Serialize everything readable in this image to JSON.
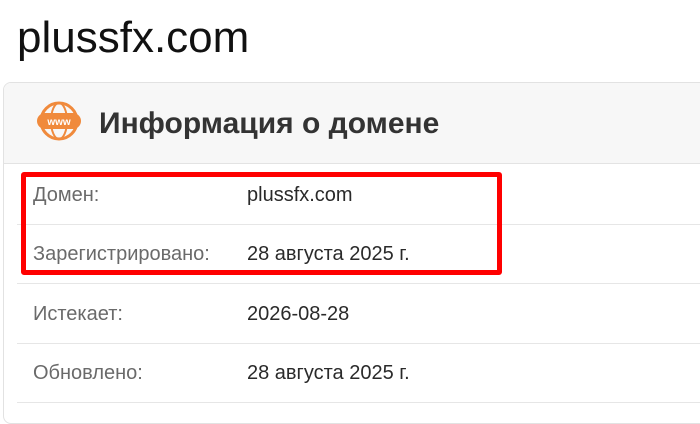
{
  "page": {
    "title": "plussfx.com"
  },
  "card": {
    "title": "Информация о домене",
    "icon": "www-globe-icon",
    "accent_color": "#f08a3c",
    "rows": [
      {
        "label": "Домен:",
        "value": "plussfx.com"
      },
      {
        "label": "Зарегистрировано:",
        "value": "28 августа 2025 г."
      },
      {
        "label": "Истекает:",
        "value": "2026-08-28"
      },
      {
        "label": "Обновлено:",
        "value": "28 августа 2025 г."
      }
    ]
  },
  "annotation": {
    "color": "#ff0000"
  }
}
